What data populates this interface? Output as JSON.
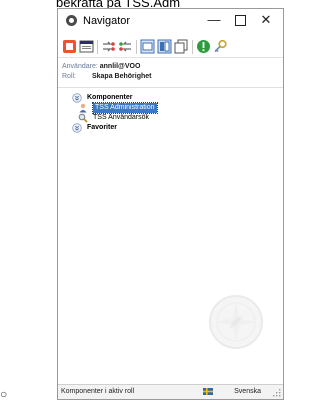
{
  "caption": {
    "top_text": "bekräfta på TSS.Adm",
    "bottom_text": "○"
  },
  "window": {
    "title": "Navigator",
    "minimize_glyph": "—",
    "close_glyph": "✕"
  },
  "toolbar": {
    "buttons": [
      "stop-icon",
      "window-icon",
      "arrows-icon",
      "arrows-icon",
      "panel-icon",
      "panel-icon",
      "copy-icon",
      "info-icon",
      "key-icon"
    ]
  },
  "user_info": {
    "user_label": "Användare:",
    "user_value": "annlil@VOO",
    "role_label": "Roll:",
    "role_value": "Skapa Behörighet"
  },
  "tree": {
    "items": [
      {
        "label": "Komponenter",
        "bold": true
      },
      {
        "label": "TSS Administration",
        "selected": true
      },
      {
        "label": "TSS Användarsök"
      },
      {
        "label": "Favoriter",
        "bold": true
      }
    ]
  },
  "statusbar": {
    "text": "Komponenter i aktiv roll",
    "language": "Svenska"
  }
}
